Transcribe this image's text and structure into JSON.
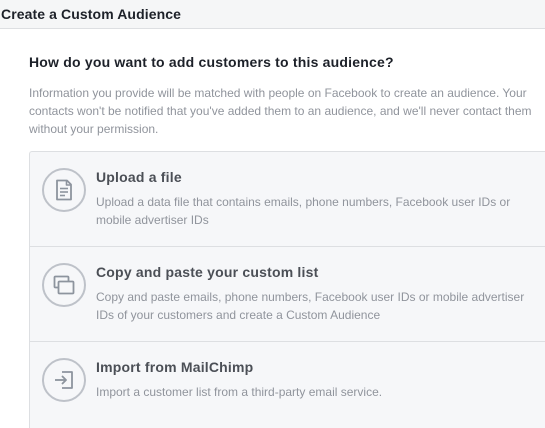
{
  "header": {
    "title": "Create a Custom Audience"
  },
  "main": {
    "question": "How do you want to add customers to this audience?",
    "description": "Information you provide will be matched with people on Facebook to create an audience. Your contacts won't be notified that you've added them to an audience, and we'll never contact them without your permission.",
    "options": [
      {
        "icon": "file-icon",
        "title": "Upload a file",
        "subtitle": "Upload a data file that contains emails, phone numbers, Facebook user IDs or mobile advertiser IDs"
      },
      {
        "icon": "copy-paste-icon",
        "title": "Copy and paste your custom list",
        "subtitle": "Copy and paste emails, phone numbers, Facebook user IDs or mobile advertiser IDs of your customers and create a Custom Audience"
      },
      {
        "icon": "import-icon",
        "title": "Import from MailChimp",
        "subtitle": "Import a customer list from a third-party email service."
      }
    ]
  },
  "colors": {
    "title_text": "#1d2129",
    "body_text": "#4b4f56",
    "muted_text": "#90949c",
    "border": "#dddfe2",
    "option_bg": "#f6f7f9",
    "icon_stroke": "#8d949e"
  }
}
